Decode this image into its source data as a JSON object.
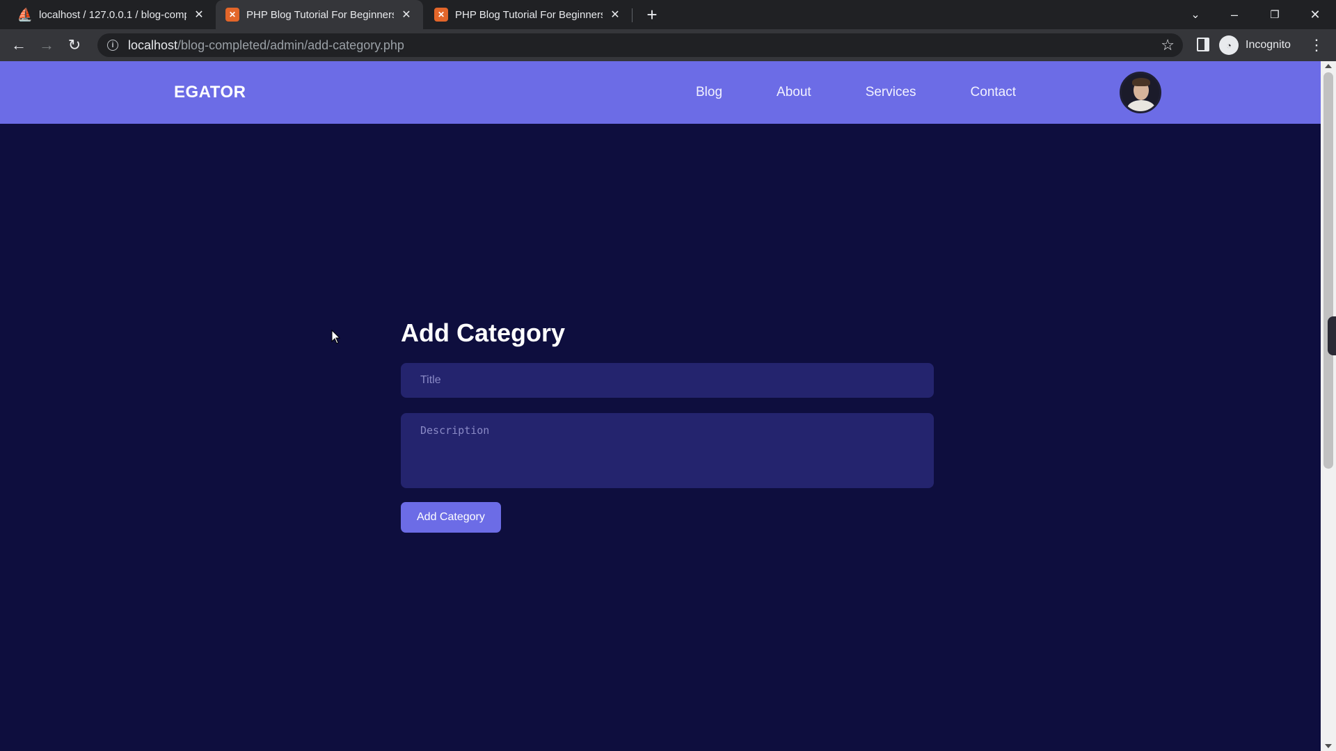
{
  "browser": {
    "tabs": [
      {
        "title": "localhost / 127.0.0.1 / blog-comp",
        "icon": "phpmyadmin-icon"
      },
      {
        "title": "PHP Blog Tutorial For Beginners",
        "icon": "xampp-icon"
      },
      {
        "title": "PHP Blog Tutorial For Beginners",
        "icon": "xampp-icon"
      }
    ],
    "url_host": "localhost",
    "url_path": "/blog-completed/admin/add-category.php",
    "profile_label": "Incognito"
  },
  "site": {
    "logo": "EGATOR",
    "nav": {
      "blog": "Blog",
      "about": "About",
      "services": "Services",
      "contact": "Contact"
    }
  },
  "form": {
    "heading": "Add Category",
    "title_placeholder": "Title",
    "title_value": "",
    "description_placeholder": "Description",
    "description_value": "",
    "submit_label": "Add Category"
  },
  "colors": {
    "nav_bg": "#6c6ce6",
    "page_bg": "#0e0e3e",
    "input_bg": "#24246e",
    "button_bg": "#6c6ce6"
  }
}
